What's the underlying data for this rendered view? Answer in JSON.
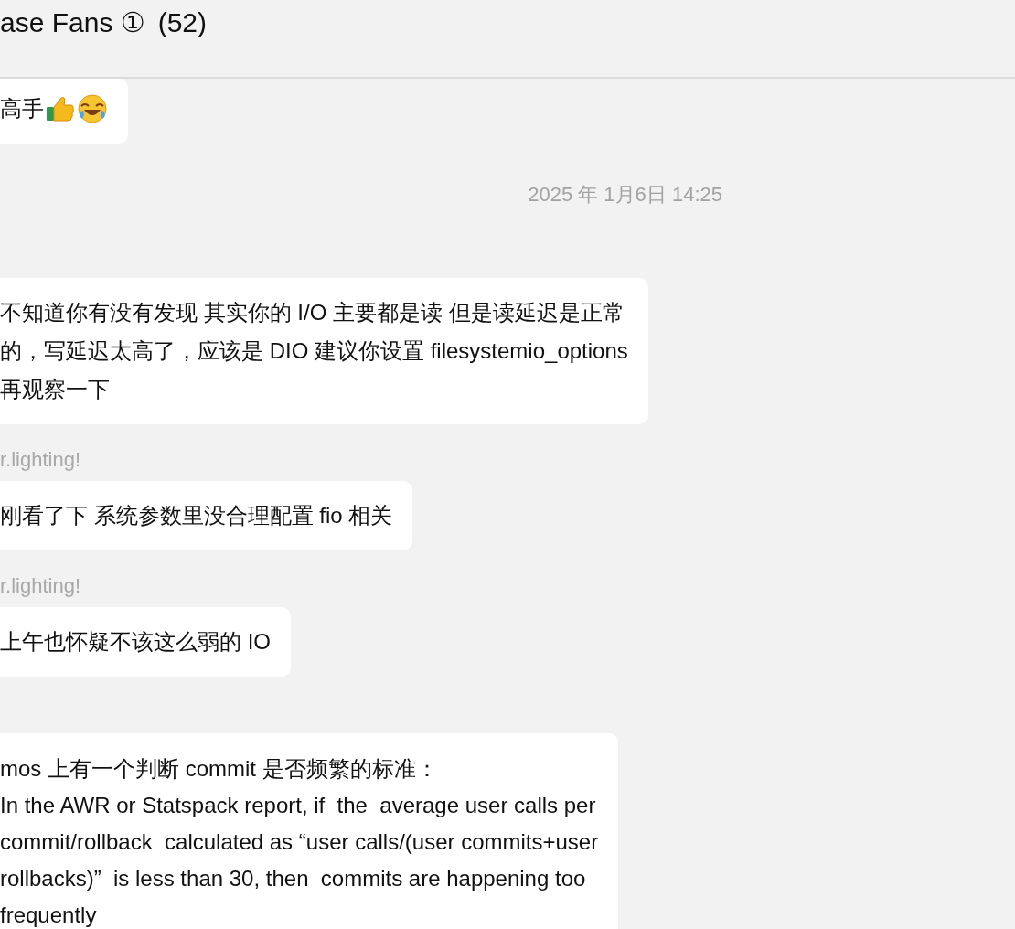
{
  "header": {
    "title": "ase Fans ①",
    "count": "(52)"
  },
  "messages": [
    {
      "kind": "text_with_emoji",
      "text": "高手"
    },
    {
      "kind": "timestamp",
      "text": "2025 年 1月6日 14:25"
    },
    {
      "kind": "text",
      "lines": [
        "不知道你有没有发现 其实你的 I/O 主要都是读 但是读延迟是正常",
        "的，写延迟太高了，应该是 DIO 建议你设置 filesystemio_options",
        "再观察一下"
      ]
    },
    {
      "kind": "text",
      "sender": "r.lighting!",
      "text": "刚看了下 系统参数里没合理配置 fio 相关"
    },
    {
      "kind": "text",
      "sender": "r.lighting!",
      "text": "上午也怀疑不该这么弱的 IO"
    },
    {
      "kind": "text",
      "text": "mos 上有一个判断 commit 是否频繁的标准：\nIn the AWR or Statspack report, if  the  average user calls per\ncommit/rollback  calculated as “user calls/(user commits+user\nrollbacks)”  is less than 30, then  commits are happening too\nfrequently"
    }
  ]
}
